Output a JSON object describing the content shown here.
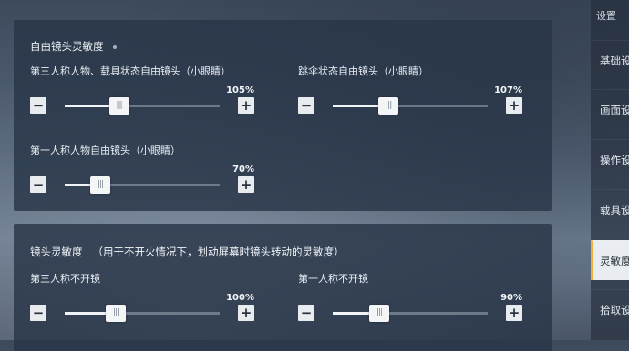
{
  "sidebar": {
    "header": "设置",
    "items": [
      {
        "label": "基础设",
        "active": false
      },
      {
        "label": "画面设",
        "active": false
      },
      {
        "label": "操作设",
        "active": false
      },
      {
        "label": "载具设",
        "active": false
      },
      {
        "label": "灵敏度",
        "active": true
      },
      {
        "label": "拾取设",
        "active": false
      }
    ]
  },
  "free_camera": {
    "title": "自由镜头灵敏度",
    "sliders": [
      {
        "label": "第三人称人物、载具状态自由镜头（小眼睛）",
        "value": "105%",
        "fraction": 0.35
      },
      {
        "label": "跳伞状态自由镜头（小眼睛）",
        "value": "107%",
        "fraction": 0.36
      },
      {
        "label": "第一人称人物自由镜头（小眼睛）",
        "value": "70%",
        "fraction": 0.23
      }
    ]
  },
  "camera": {
    "title": "镜头灵敏度",
    "subtitle": "（用于不开火情况下，划动屏幕时镜头转动的灵敏度）",
    "sliders": [
      {
        "label": "第三人称不开镜",
        "value": "100%",
        "fraction": 0.33
      },
      {
        "label": "第一人称不开镜",
        "value": "90%",
        "fraction": 0.3
      }
    ]
  },
  "controls": {
    "minus": "−",
    "plus": "+",
    "thumb_grip": "|||"
  },
  "colors": {
    "accent": "#f2b233",
    "panel": "#283648"
  }
}
